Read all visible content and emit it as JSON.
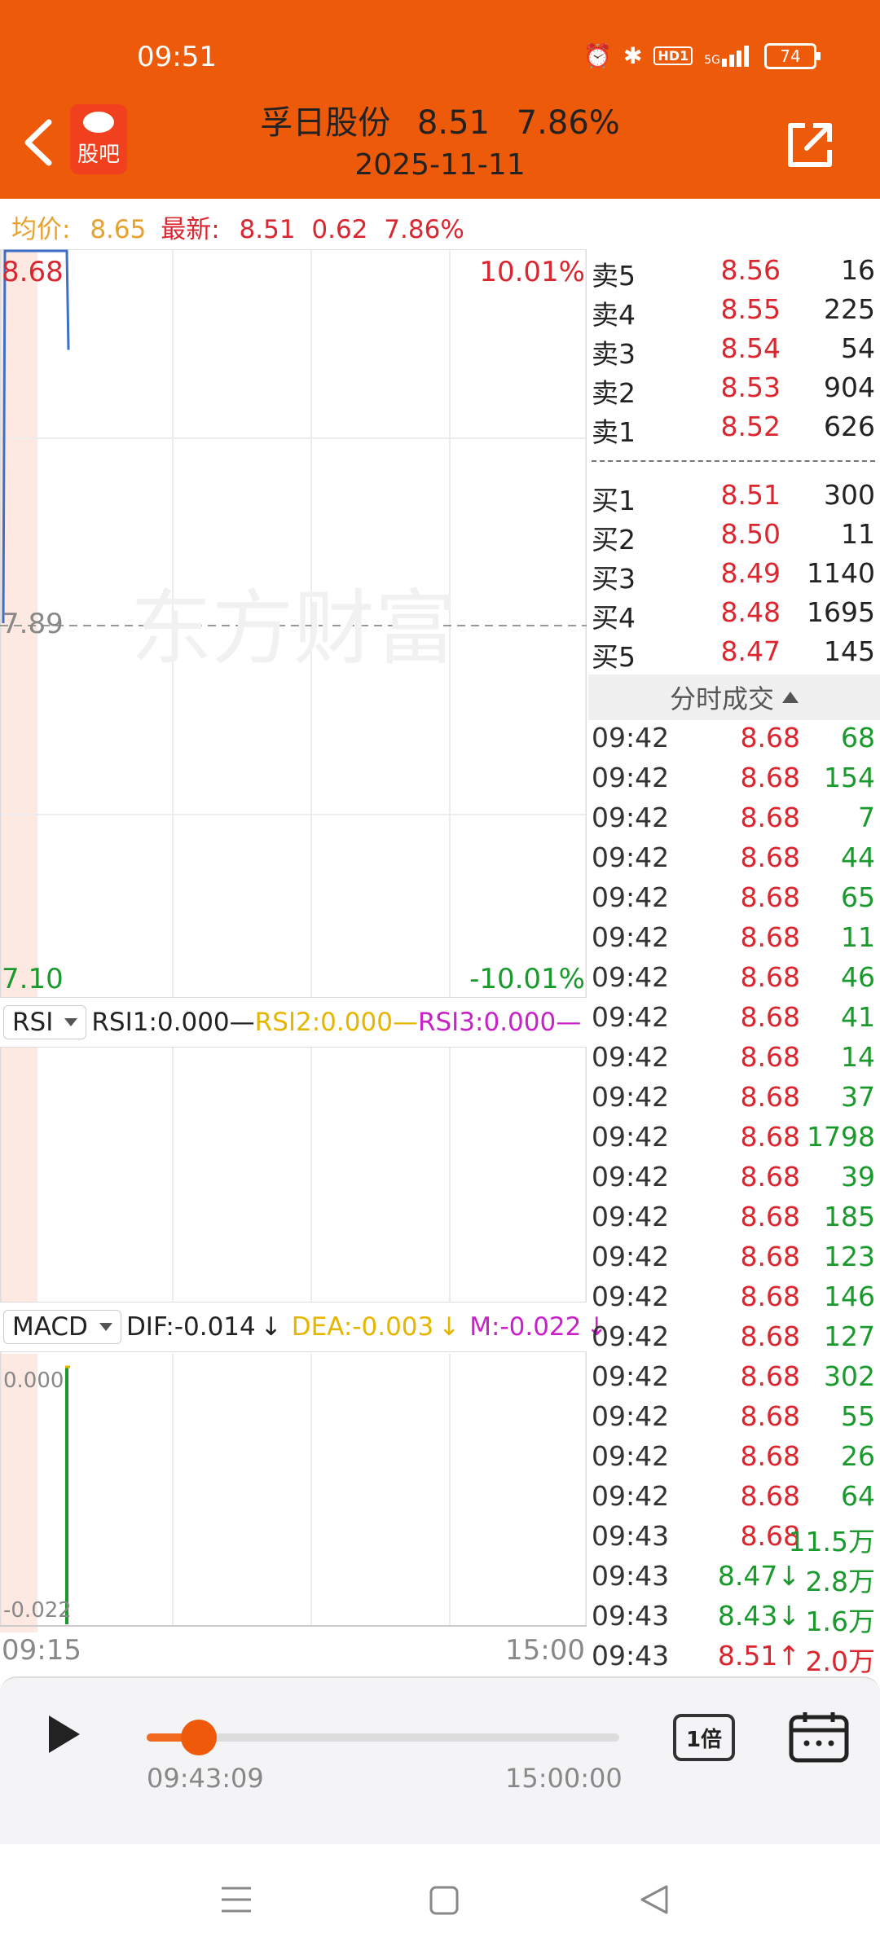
{
  "status_bar": {
    "time": "09:51",
    "battery": "74",
    "network": "5G",
    "hd_badge": "HD1"
  },
  "header": {
    "stock_name": "孚日股份",
    "price": "8.51",
    "change_pct": "7.86%",
    "date": "2025-11-11",
    "guba_label": "股吧",
    "colors": {
      "bg": "#ec5a0a"
    }
  },
  "info_line": {
    "avg_label": "均价:",
    "avg_value": "8.65",
    "latest_label": "最新:",
    "latest_value": "8.51",
    "change": "0.62",
    "change_pct": "7.86%"
  },
  "chart_data": {
    "type": "line",
    "title": "",
    "price_axis": {
      "max": "8.68",
      "mid": "7.89",
      "min": "7.10",
      "max_pct": "10.01%",
      "min_pct": "-10.01%",
      "ylim": [
        7.1,
        8.68
      ]
    },
    "time_axis": {
      "start": "09:15",
      "end": "15:00"
    },
    "series": [
      {
        "values": [
          7.89,
          8.68,
          8.68,
          8.68,
          8.47
        ]
      }
    ],
    "watermark": "东方财富",
    "rsi": {
      "selector": "RSI",
      "rsi1": "RSI1:0.000",
      "rsi2": "RSI2:0.000",
      "rsi3": "RSI3:0.000"
    },
    "macd": {
      "selector": "MACD",
      "dif": "DIF:-0.014",
      "dea": "DEA:-0.003",
      "m": "M:-0.022",
      "top_label": "0.000",
      "bottom_label": "-0.022"
    }
  },
  "order_book": {
    "asks": [
      {
        "label": "卖5",
        "price": "8.56",
        "volume": "16"
      },
      {
        "label": "卖4",
        "price": "8.55",
        "volume": "225"
      },
      {
        "label": "卖3",
        "price": "8.54",
        "volume": "54"
      },
      {
        "label": "卖2",
        "price": "8.53",
        "volume": "904"
      },
      {
        "label": "卖1",
        "price": "8.52",
        "volume": "626"
      }
    ],
    "bids": [
      {
        "label": "买1",
        "price": "8.51",
        "volume": "300"
      },
      {
        "label": "买2",
        "price": "8.50",
        "volume": "11"
      },
      {
        "label": "买3",
        "price": "8.49",
        "volume": "1140"
      },
      {
        "label": "买4",
        "price": "8.48",
        "volume": "1695"
      },
      {
        "label": "买5",
        "price": "8.47",
        "volume": "145"
      }
    ]
  },
  "trades": {
    "header": "分时成交",
    "rows": [
      {
        "time": "09:42",
        "price": "8.68",
        "volume": "68",
        "color": "green"
      },
      {
        "time": "09:42",
        "price": "8.68",
        "volume": "154",
        "color": "green"
      },
      {
        "time": "09:42",
        "price": "8.68",
        "volume": "7",
        "color": "green"
      },
      {
        "time": "09:42",
        "price": "8.68",
        "volume": "44",
        "color": "green"
      },
      {
        "time": "09:42",
        "price": "8.68",
        "volume": "65",
        "color": "green"
      },
      {
        "time": "09:42",
        "price": "8.68",
        "volume": "11",
        "color": "green"
      },
      {
        "time": "09:42",
        "price": "8.68",
        "volume": "46",
        "color": "green"
      },
      {
        "time": "09:42",
        "price": "8.68",
        "volume": "41",
        "color": "green"
      },
      {
        "time": "09:42",
        "price": "8.68",
        "volume": "14",
        "color": "green"
      },
      {
        "time": "09:42",
        "price": "8.68",
        "volume": "37",
        "color": "green"
      },
      {
        "time": "09:42",
        "price": "8.68",
        "volume": "1798",
        "color": "green"
      },
      {
        "time": "09:42",
        "price": "8.68",
        "volume": "39",
        "color": "green"
      },
      {
        "time": "09:42",
        "price": "8.68",
        "volume": "185",
        "color": "green"
      },
      {
        "time": "09:42",
        "price": "8.68",
        "volume": "123",
        "color": "green"
      },
      {
        "time": "09:42",
        "price": "8.68",
        "volume": "146",
        "color": "green"
      },
      {
        "time": "09:42",
        "price": "8.68",
        "volume": "127",
        "color": "green"
      },
      {
        "time": "09:42",
        "price": "8.68",
        "volume": "302",
        "color": "green"
      },
      {
        "time": "09:42",
        "price": "8.68",
        "volume": "55",
        "color": "green"
      },
      {
        "time": "09:42",
        "price": "8.68",
        "volume": "26",
        "color": "green"
      },
      {
        "time": "09:42",
        "price": "8.68",
        "volume": "64",
        "color": "green"
      },
      {
        "time": "09:43",
        "price": "8.68",
        "volume": "11.5万",
        "color": "green"
      },
      {
        "time": "09:43",
        "price": "8.47↓",
        "volume": "2.8万",
        "color": "green"
      },
      {
        "time": "09:43",
        "price": "8.43↓",
        "volume": "1.6万",
        "color": "green"
      },
      {
        "time": "09:43",
        "price": "8.51↑",
        "volume": "2.0万",
        "color": "red"
      }
    ]
  },
  "playback": {
    "current_time": "09:43:09",
    "end_time": "15:00:00",
    "speed_label": "1倍",
    "progress": 0.11
  }
}
